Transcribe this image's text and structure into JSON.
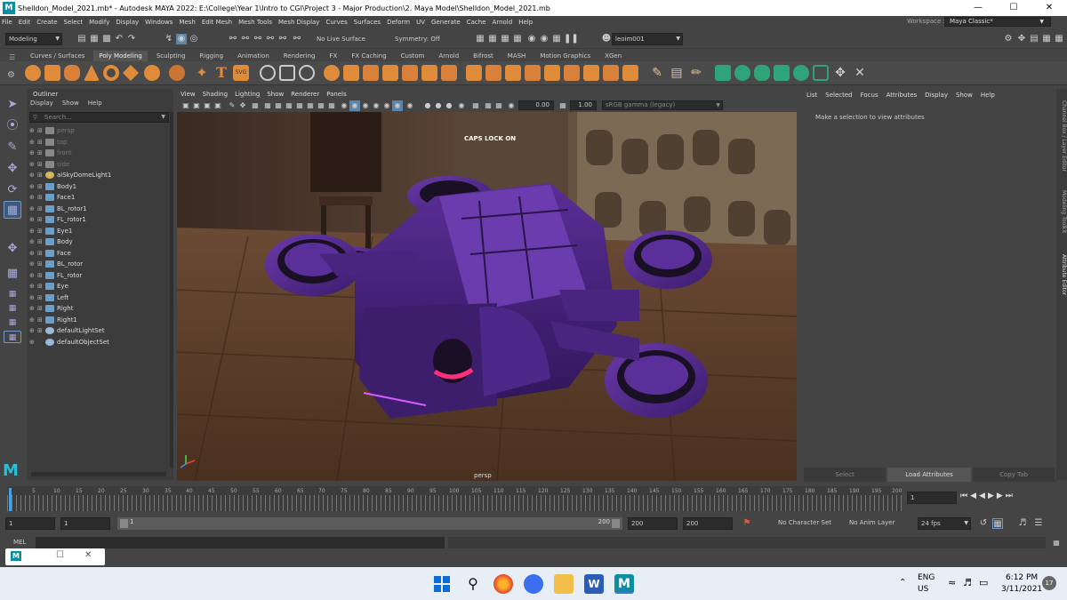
{
  "title_bar": {
    "title": "Shelldon_Model_2021.mb* - Autodesk MAYA 2022: E:\\College\\Year 1\\Intro to CGI\\Project 3 - Major Production\\2. Maya Model\\Shelldon_Model_2021.mb",
    "logo": "M"
  },
  "menu_bar": [
    "File",
    "Edit",
    "Create",
    "Select",
    "Modify",
    "Display",
    "Windows",
    "Mesh",
    "Edit Mesh",
    "Mesh Tools",
    "Mesh Display",
    "Curves",
    "Surfaces",
    "Deform",
    "UV",
    "Generate",
    "Cache",
    "Arnold",
    "Help"
  ],
  "workspace": {
    "label": "Workspace :",
    "value": "Maya Classic*"
  },
  "status_line": {
    "menu_set": "Modeling",
    "live_surface": "No Live Surface",
    "symmetry": "Symmetry: Off",
    "user": "leoim001"
  },
  "shelf_tabs": [
    "Curves / Surfaces",
    "Poly Modeling",
    "Sculpting",
    "Rigging",
    "Animation",
    "Rendering",
    "FX",
    "FX Caching",
    "Custom",
    "Arnold",
    "Bifrost",
    "MASH",
    "Motion Graphics",
    "XGen"
  ],
  "shelf_active": "Poly Modeling",
  "outliner": {
    "title": "Outliner",
    "menu": [
      "Display",
      "Show",
      "Help"
    ],
    "search_placeholder": "Search...",
    "items": [
      {
        "label": "persp",
        "type": "camera",
        "dim": true
      },
      {
        "label": "top",
        "type": "camera",
        "dim": true
      },
      {
        "label": "front",
        "type": "camera",
        "dim": true
      },
      {
        "label": "side",
        "type": "camera",
        "dim": true
      },
      {
        "label": "aiSkyDomeLight1",
        "type": "light",
        "dim": false
      },
      {
        "label": "Body1",
        "type": "mesh",
        "dim": false
      },
      {
        "label": "Face1",
        "type": "mesh",
        "dim": false
      },
      {
        "label": "BL_rotor1",
        "type": "mesh",
        "dim": false
      },
      {
        "label": "FL_rotor1",
        "type": "mesh",
        "dim": false
      },
      {
        "label": "Eye1",
        "type": "mesh",
        "dim": false
      },
      {
        "label": "Body",
        "type": "mesh",
        "dim": false
      },
      {
        "label": "Face",
        "type": "mesh",
        "dim": false
      },
      {
        "label": "BL_rotor",
        "type": "mesh",
        "dim": false
      },
      {
        "label": "FL_rotor",
        "type": "mesh",
        "dim": false
      },
      {
        "label": "Eye",
        "type": "mesh",
        "dim": false
      },
      {
        "label": "Left",
        "type": "mesh",
        "dim": false
      },
      {
        "label": "Right",
        "type": "mesh",
        "dim": false
      },
      {
        "label": "Right1",
        "type": "mesh",
        "dim": false
      },
      {
        "label": "defaultLightSet",
        "type": "set",
        "dim": false
      },
      {
        "label": "defaultObjectSet",
        "type": "set",
        "dim": false
      }
    ]
  },
  "viewport": {
    "menu": [
      "View",
      "Shading",
      "Lighting",
      "Show",
      "Renderer",
      "Panels"
    ],
    "exposure": "0.00",
    "gamma": "1.00",
    "color_space": "sRGB gamma (legacy)",
    "caps_lock": "CAPS LOCK ON",
    "camera": "persp"
  },
  "attribute_editor": {
    "menu": [
      "List",
      "Selected",
      "Focus",
      "Attributes",
      "Display",
      "Show",
      "Help"
    ],
    "message": "Make a selection to view attributes",
    "buttons": [
      "Select",
      "Load Attributes",
      "Copy Tab"
    ]
  },
  "side_tabs": [
    "Channel Box / Layer Editor",
    "Modeling Toolkit",
    "Attribute Editor"
  ],
  "timeline": {
    "ticks": [
      "5",
      "10",
      "15",
      "20",
      "25",
      "30",
      "35",
      "40",
      "45",
      "50",
      "55",
      "60",
      "65",
      "70",
      "75",
      "80",
      "85",
      "90",
      "95",
      "100",
      "105",
      "110",
      "115",
      "120",
      "125",
      "130",
      "135",
      "140",
      "145",
      "150",
      "155",
      "160",
      "165",
      "170",
      "175",
      "180",
      "185",
      "190",
      "195",
      "200"
    ],
    "current_frame": "1"
  },
  "range": {
    "start": "1",
    "anim_start": "1",
    "slider_start": "1",
    "slider_end": "200",
    "anim_end": "200",
    "end": "200",
    "character_set": "No Character Set",
    "anim_layer": "No Anim Layer",
    "fps": "24 fps"
  },
  "command_line": {
    "label": "MEL"
  },
  "taskbar": {
    "lang": "ENG",
    "region": "US",
    "time": "6:12 PM",
    "date": "3/11/2021",
    "notifications": "17"
  }
}
